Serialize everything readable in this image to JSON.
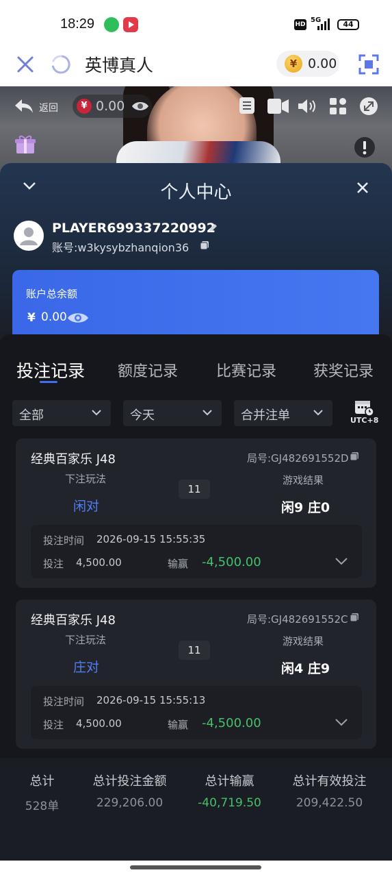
{
  "status_bar": {
    "time": "18:29",
    "hd": "HD",
    "network": "5G",
    "battery": "44"
  },
  "header": {
    "title": "英博真人",
    "balance": "0.00",
    "currency_symbol": "¥",
    "icons": [
      "close-icon",
      "refresh-icon",
      "fullscreen-icon"
    ]
  },
  "video": {
    "back_label": "返回",
    "balance": "0.00",
    "currency_symbol": "¥",
    "icons": [
      "back-arrow-icon",
      "eye-icon",
      "menu-icon",
      "camera-icon",
      "volume-icon",
      "grid-icon",
      "resize-icon",
      "gift-icon",
      "alert-icon"
    ]
  },
  "personal_center": {
    "title": "个人中心",
    "player_name": "PLAYER699337220992",
    "account_prefix": "账号:",
    "account": "w3kysybzhanqion36",
    "balance_label": "账户总余额",
    "currency_symbol": "¥",
    "balance": "0.00"
  },
  "tabs": [
    {
      "label": "投注记录",
      "active": true
    },
    {
      "label": "额度记录",
      "active": false
    },
    {
      "label": "比赛记录",
      "active": false
    },
    {
      "label": "获奖记录",
      "active": false
    }
  ],
  "filters": {
    "type": "全部",
    "date": "今天",
    "merge": "合并注单",
    "timezone": "UTC+8"
  },
  "records": [
    {
      "game": "经典百家乐 J48",
      "round_id": "局号:GJ482691552D",
      "bet_type_label": "下注玩法",
      "bet_type": "闲对",
      "result_label": "游戏结果",
      "result": "闲9 庄0",
      "seq": "11",
      "time_label": "投注时间",
      "time": "2026-09-15 15:55:35",
      "bet_label": "投注",
      "bet_amount": "4,500.00",
      "winloss_label": "输赢",
      "winloss": "-4,500.00"
    },
    {
      "game": "经典百家乐 J48",
      "round_id": "局号:GJ482691552C",
      "bet_type_label": "下注玩法",
      "bet_type": "庄对",
      "result_label": "游戏结果",
      "result": "闲4 庄9",
      "seq": "11",
      "time_label": "投注时间",
      "time": "2026-09-15 15:55:13",
      "bet_label": "投注",
      "bet_amount": "4,500.00",
      "winloss_label": "输赢",
      "winloss": "-4,500.00"
    }
  ],
  "totals": {
    "labels": [
      "总计",
      "总计投注金额",
      "总计输赢",
      "总计有效投注"
    ],
    "values": [
      "528单",
      "229,206.00",
      "-40,719.50",
      "209,422.50"
    ]
  },
  "colors": {
    "accent": "#3f6ef0",
    "negative": "#46c06a",
    "panel_bg": "#16171c",
    "card_blue": "#4677f0"
  }
}
